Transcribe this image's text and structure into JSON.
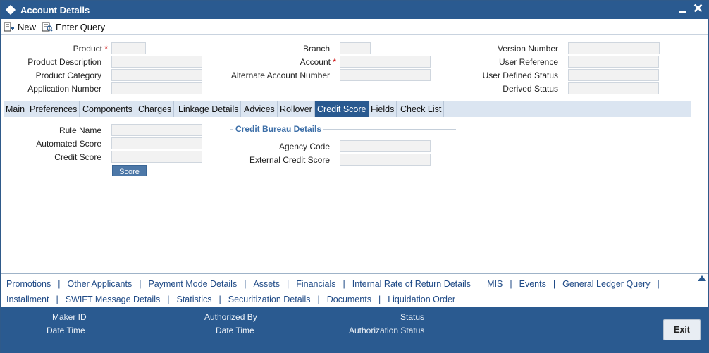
{
  "window": {
    "title": "Account Details"
  },
  "toolbar": {
    "new_label": "New",
    "enter_query_label": "Enter Query"
  },
  "header": {
    "product_label": "Product",
    "product_description_label": "Product Description",
    "product_category_label": "Product Category",
    "application_number_label": "Application Number",
    "branch_label": "Branch",
    "account_label": "Account",
    "alternate_account_number_label": "Alternate Account Number",
    "version_number_label": "Version Number",
    "user_reference_label": "User Reference",
    "user_defined_status_label": "User Defined Status",
    "derived_status_label": "Derived Status",
    "required_marker": "*"
  },
  "tabs": [
    {
      "label": "Main"
    },
    {
      "label": "Preferences"
    },
    {
      "label": "Components"
    },
    {
      "label": "Charges"
    },
    {
      "label": "Linkage Details"
    },
    {
      "label": "Advices"
    },
    {
      "label": "Rollover"
    },
    {
      "label": "Credit Score"
    },
    {
      "label": "Fields"
    },
    {
      "label": "Check List"
    }
  ],
  "credit_score": {
    "rule_name_label": "Rule Name",
    "automated_score_label": "Automated Score",
    "credit_score_label": "Credit Score",
    "score_button_label": "Score",
    "bureau_legend": "Credit Bureau Details",
    "agency_code_label": "Agency Code",
    "external_credit_score_label": "External Credit Score"
  },
  "links": {
    "row1": [
      "Promotions",
      "Other Applicants",
      "Payment Mode Details",
      "Assets",
      "Financials",
      "Internal Rate of Return Details",
      "MIS",
      "Events",
      "General Ledger Query"
    ],
    "row2": [
      "Installment",
      "SWIFT Message Details",
      "Statistics",
      "Securitization Details",
      "Documents",
      "Liquidation Order"
    ],
    "separator": "|"
  },
  "footer": {
    "maker_id_label": "Maker ID",
    "date_time_label_1": "Date Time",
    "authorized_by_label": "Authorized By",
    "date_time_label_2": "Date Time",
    "status_label": "Status",
    "authorization_status_label": "Authorization Status",
    "exit_label": "Exit"
  },
  "colors": {
    "brand": "#2a5a90",
    "tab_bar": "#dbe5f1",
    "link": "#1f4a86",
    "required": "#cc0000"
  }
}
